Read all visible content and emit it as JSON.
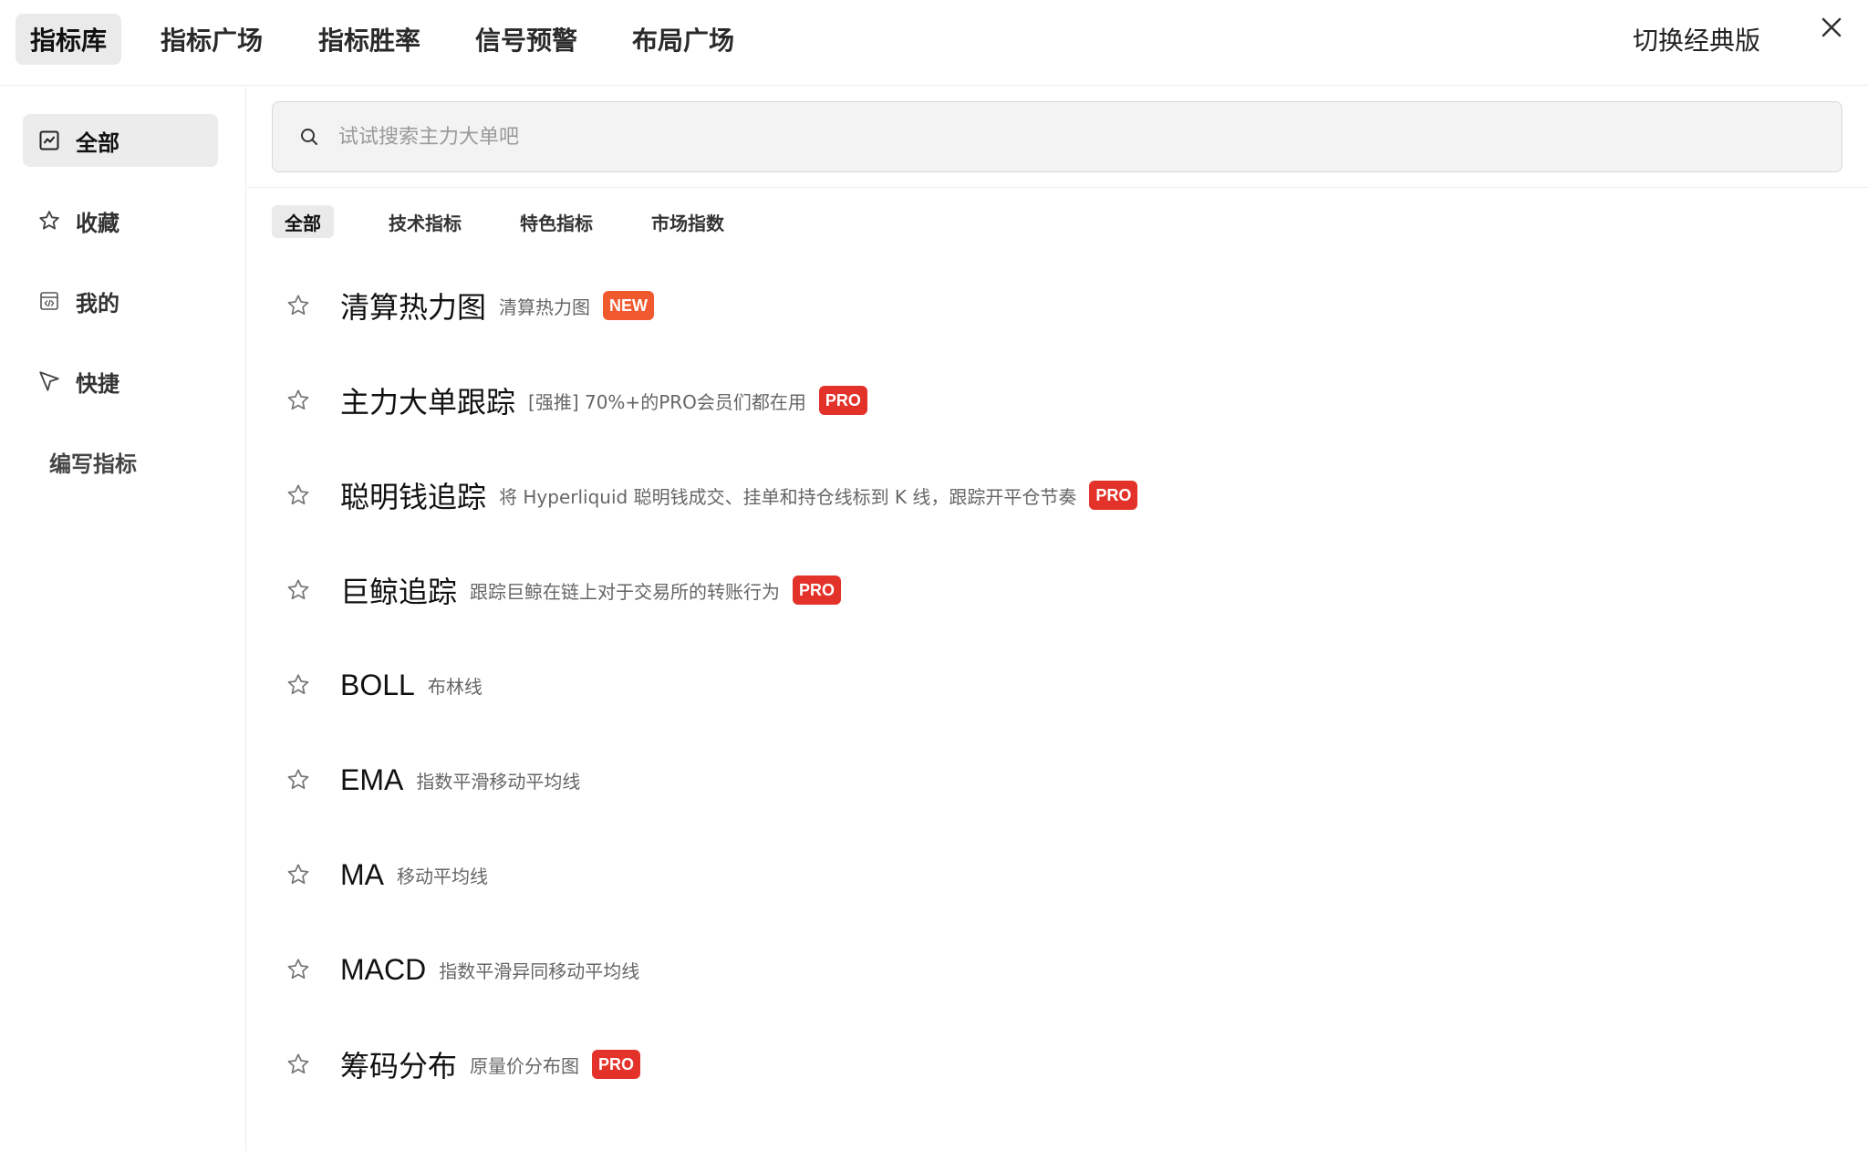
{
  "top_tabs": [
    {
      "label": "指标库",
      "active": true
    },
    {
      "label": "指标广场",
      "active": false
    },
    {
      "label": "指标胜率",
      "active": false
    },
    {
      "label": "信号预警",
      "active": false
    },
    {
      "label": "布局广场",
      "active": false
    }
  ],
  "switch_classic_label": "切换经典版",
  "sidebar": {
    "items": [
      {
        "label": "全部",
        "icon": "chart-box-icon",
        "active": true
      },
      {
        "label": "收藏",
        "icon": "star-icon",
        "active": false
      },
      {
        "label": "我的",
        "icon": "code-file-icon",
        "active": false
      },
      {
        "label": "快捷",
        "icon": "cursor-icon",
        "active": false
      },
      {
        "label": "编写指标",
        "icon": "",
        "active": false
      }
    ]
  },
  "search": {
    "placeholder": "试试搜索主力大单吧",
    "value": ""
  },
  "category_tabs": [
    {
      "label": "全部",
      "active": true
    },
    {
      "label": "技术指标",
      "active": false
    },
    {
      "label": "特色指标",
      "active": false
    },
    {
      "label": "市场指数",
      "active": false
    }
  ],
  "indicators": [
    {
      "name": "清算热力图",
      "desc": "清算热力图",
      "badge": "NEW"
    },
    {
      "name": "主力大单跟踪",
      "desc": "[强推] 70%+的PRO会员们都在用",
      "badge": "PRO"
    },
    {
      "name": "聪明钱追踪",
      "desc": "将 Hyperliquid 聪明钱成交、挂单和持仓线标到 K 线，跟踪开平仓节奏",
      "badge": "PRO"
    },
    {
      "name": "巨鲸追踪",
      "desc": "跟踪巨鲸在链上对于交易所的转账行为",
      "badge": "PRO"
    },
    {
      "name": "BOLL",
      "desc": "布林线",
      "badge": ""
    },
    {
      "name": "EMA",
      "desc": "指数平滑移动平均线",
      "badge": ""
    },
    {
      "name": "MA",
      "desc": "移动平均线",
      "badge": ""
    },
    {
      "name": "MACD",
      "desc": "指数平滑异同移动平均线",
      "badge": ""
    },
    {
      "name": "筹码分布",
      "desc": "原量价分布图",
      "badge": "PRO"
    }
  ],
  "colors": {
    "pro_badge": "#e3322a",
    "new_badge": "#f0582e",
    "active_bg": "#eaeaea"
  }
}
